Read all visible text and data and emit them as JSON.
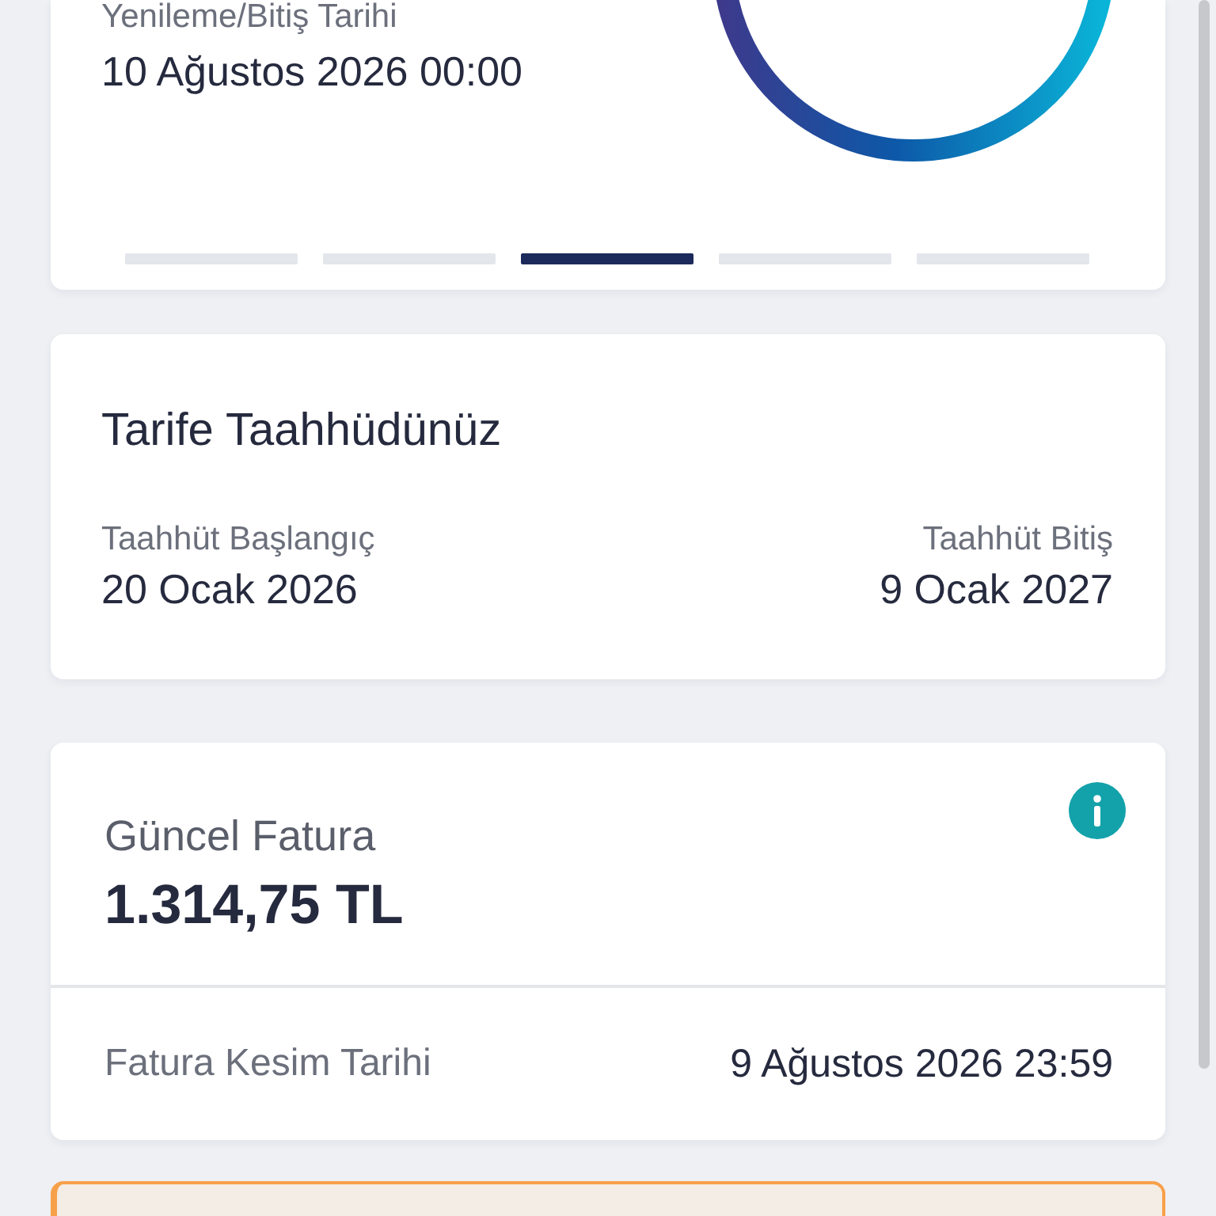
{
  "renewal": {
    "label": "Yenileme/Bitiş Tarihi",
    "value": "10 Ağustos 2026 00:00"
  },
  "carousel": {
    "pages": [
      {
        "selected": false
      },
      {
        "selected": false
      },
      {
        "selected": true
      },
      {
        "selected": false
      },
      {
        "selected": false
      }
    ]
  },
  "commitment": {
    "title": "Tarife Taahhüdünüz",
    "start": {
      "label": "Taahhüt Başlangıç",
      "value": "20 Ocak 2026"
    },
    "end": {
      "label": "Taahhüt Bitiş",
      "value": "9 Ocak 2027"
    }
  },
  "invoice": {
    "title": "Güncel Fatura",
    "amount": "1.314,75 TL",
    "cutoff": {
      "label": "Fatura Kesim Tarihi",
      "value": "9 Ağustos 2026 23:59"
    }
  }
}
